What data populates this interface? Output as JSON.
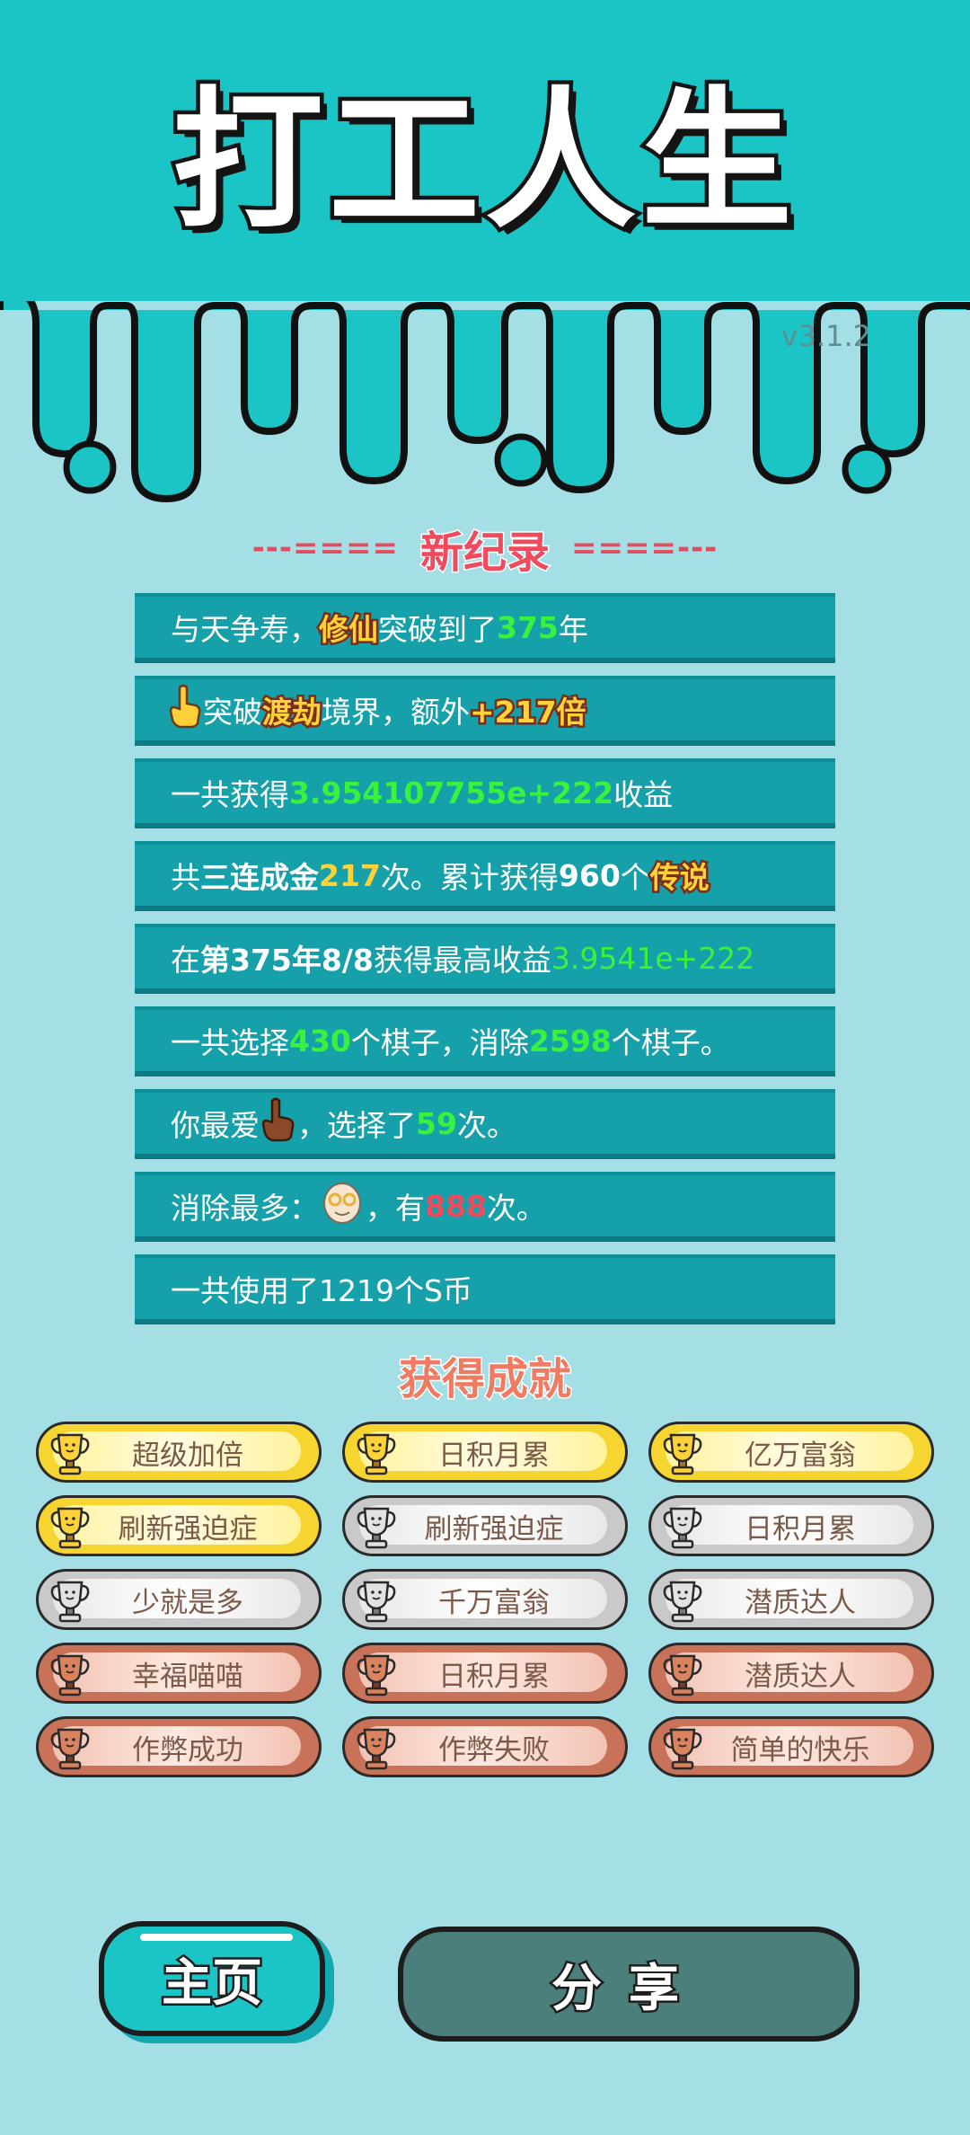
{
  "header": {
    "app_title": "打工人生",
    "version": "v3.1.2"
  },
  "records_section": {
    "title": "新纪录",
    "deco_left": "---====",
    "deco_right": "====---"
  },
  "records": {
    "r1": {
      "a": "与天争寿，",
      "b": "修仙",
      "c": "突破到了",
      "d": "375",
      "e": "年"
    },
    "r2": {
      "a": "突破",
      "b": "渡劫",
      "c": "境界，额外",
      "d": "+217倍"
    },
    "r3": {
      "a": "一共获得",
      "b": "3.954107755e+222",
      "c": "收益"
    },
    "r4": {
      "a": "共",
      "b": "三连成金",
      "c": "217",
      "d": "次。累计获得",
      "e": "960",
      "f": "个",
      "g": "传说"
    },
    "r5": {
      "a": "在 ",
      "b": "第375年8/8",
      "c": " 获得最高收益",
      "d": "3.9541e+222"
    },
    "r6": {
      "a": "一共选择",
      "b": "430",
      "c": "个棋子，消除",
      "d": "2598",
      "e": "个棋子。"
    },
    "r7": {
      "a": "你最爱",
      "c": "，选择了",
      "d": "59",
      "e": "次。"
    },
    "r8": {
      "a": "消除最多：",
      "c": "，有",
      "d": "888",
      "e": "次。"
    },
    "r9": {
      "a": "一共使用了1219个S币"
    }
  },
  "achievements_section": {
    "title": "获得成就"
  },
  "achievements": [
    {
      "label": "超级加倍",
      "tier": "gold"
    },
    {
      "label": "日积月累",
      "tier": "gold"
    },
    {
      "label": "亿万富翁",
      "tier": "gold"
    },
    {
      "label": "刷新强迫症",
      "tier": "gold"
    },
    {
      "label": "刷新强迫症",
      "tier": "silver"
    },
    {
      "label": "日积月累",
      "tier": "silver"
    },
    {
      "label": "少就是多",
      "tier": "silver"
    },
    {
      "label": "千万富翁",
      "tier": "silver"
    },
    {
      "label": "潜质达人",
      "tier": "silver"
    },
    {
      "label": "幸福喵喵",
      "tier": "bronze"
    },
    {
      "label": "日积月累",
      "tier": "bronze"
    },
    {
      "label": "潜质达人",
      "tier": "bronze"
    },
    {
      "label": "作弊成功",
      "tier": "bronze"
    },
    {
      "label": "作弊失败",
      "tier": "bronze"
    },
    {
      "label": "简单的快乐",
      "tier": "bronze"
    }
  ],
  "buttons": {
    "home": "主页",
    "share": "分享"
  },
  "colors": {
    "teal": "#1bc5c5",
    "background": "#a3dfe5",
    "record_row": "#16a1aa",
    "highlight_green": "#39f23d",
    "highlight_yellow": "#ffd335",
    "highlight_red": "#ef4b5e"
  },
  "icons": {
    "pointing_hand": "pointing-hand-icon",
    "brown_hand": "brown-hand-icon",
    "old_man": "old-man-face-icon",
    "trophy": "trophy-icon"
  }
}
